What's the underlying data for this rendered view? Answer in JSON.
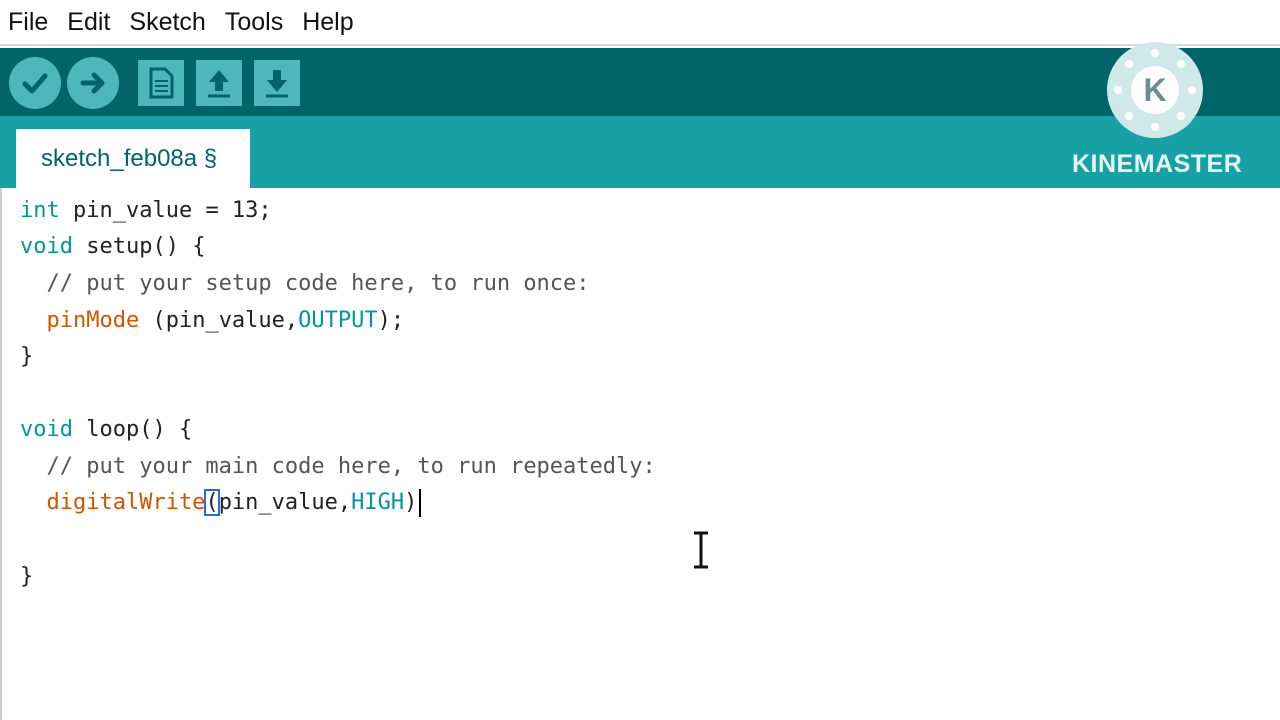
{
  "menu": [
    "File",
    "Edit",
    "Sketch",
    "Tools",
    "Help"
  ],
  "toolbar": {
    "buttons": [
      {
        "name": "verify-button",
        "icon": "check-icon"
      },
      {
        "name": "upload-button",
        "icon": "arrow-right-icon"
      },
      {
        "name": "new-button",
        "icon": "document-icon"
      },
      {
        "name": "open-button",
        "icon": "arrow-up-icon"
      },
      {
        "name": "save-button",
        "icon": "arrow-down-icon"
      }
    ]
  },
  "tab": {
    "label": "sketch_feb08a §"
  },
  "watermark": {
    "letter": "K",
    "text": "KINEMASTER"
  },
  "code": {
    "l1": {
      "type": "int",
      "rest": " pin_value = 13;"
    },
    "l2": {
      "kw": "void",
      "fn": " setup",
      "rest": "() {"
    },
    "l3": {
      "comment": "  // put your setup code here, to run once:"
    },
    "l4": {
      "fn": "  pinMode",
      "mid": " (pin_value,",
      "const": "OUTPUT",
      "end": ");"
    },
    "l5": {
      "text": "}"
    },
    "l7": {
      "kw": "void",
      "fn": " loop",
      "rest": "() {"
    },
    "l8": {
      "comment": "  // put your main code here, to run repeatedly:"
    },
    "l9": {
      "fn": "  digitalWrite",
      "open": "(",
      "mid": "pin_value,",
      "const": "HIGH",
      "end": ")"
    },
    "l11": {
      "text": "}"
    }
  },
  "colors": {
    "toolbar": "#006468",
    "tabstrip": "#17a1a5",
    "button": "#4db7bc",
    "keyword": "#00979d",
    "function": "#d35400"
  }
}
